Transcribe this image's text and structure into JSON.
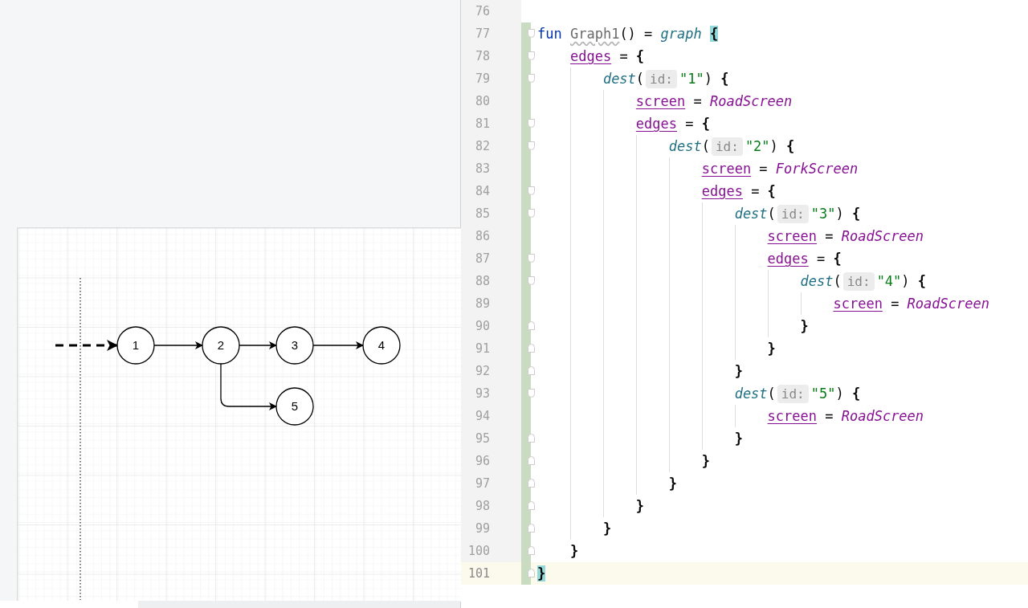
{
  "diagram": {
    "nodes": [
      {
        "label": "1"
      },
      {
        "label": "2"
      },
      {
        "label": "3"
      },
      {
        "label": "4"
      },
      {
        "label": "5"
      }
    ]
  },
  "editor": {
    "lines": [
      {
        "number": "76",
        "changed": false,
        "current": false,
        "kind": "plain"
      },
      {
        "number": "77",
        "changed": true,
        "current": false,
        "kind": "fold-start",
        "tokens": [
          {
            "kind": "keyword",
            "text": "fun "
          },
          {
            "kind": "unused",
            "text": "Graph1"
          },
          {
            "kind": "plain",
            "text": "() = "
          },
          {
            "kind": "call",
            "text": "graph "
          },
          {
            "kind": "brace-match",
            "text": "{"
          }
        ]
      },
      {
        "number": "78",
        "changed": true,
        "current": false,
        "kind": "fold-start",
        "tokens": [
          {
            "kind": "property",
            "text": "    edges"
          },
          {
            "kind": "plain",
            "text": " = "
          },
          {
            "kind": "brace",
            "text": "{"
          }
        ]
      },
      {
        "number": "79",
        "changed": true,
        "current": false,
        "kind": "fold-start",
        "tokens": [
          {
            "kind": "call",
            "text": "        dest"
          },
          {
            "kind": "plain",
            "text": "("
          },
          {
            "kind": "hint",
            "text": "id:"
          },
          {
            "kind": "string",
            "text": "\"1\""
          },
          {
            "kind": "plain",
            "text": ") "
          },
          {
            "kind": "brace",
            "text": "{"
          }
        ]
      },
      {
        "number": "80",
        "changed": true,
        "current": false,
        "kind": "plain",
        "tokens": [
          {
            "kind": "property",
            "text": "            screen"
          },
          {
            "kind": "plain",
            "text": " = "
          },
          {
            "kind": "type",
            "text": "RoadScreen"
          }
        ]
      },
      {
        "number": "81",
        "changed": true,
        "current": false,
        "kind": "fold-start",
        "tokens": [
          {
            "kind": "property",
            "text": "            edges"
          },
          {
            "kind": "plain",
            "text": " = "
          },
          {
            "kind": "brace",
            "text": "{"
          }
        ]
      },
      {
        "number": "82",
        "changed": true,
        "current": false,
        "kind": "fold-start",
        "tokens": [
          {
            "kind": "call",
            "text": "                dest"
          },
          {
            "kind": "plain",
            "text": "("
          },
          {
            "kind": "hint",
            "text": "id:"
          },
          {
            "kind": "string",
            "text": "\"2\""
          },
          {
            "kind": "plain",
            "text": ") "
          },
          {
            "kind": "brace",
            "text": "{"
          }
        ]
      },
      {
        "number": "83",
        "changed": true,
        "current": false,
        "kind": "plain",
        "tokens": [
          {
            "kind": "property",
            "text": "                    screen"
          },
          {
            "kind": "plain",
            "text": " = "
          },
          {
            "kind": "type",
            "text": "ForkScreen"
          }
        ]
      },
      {
        "number": "84",
        "changed": true,
        "current": false,
        "kind": "fold-start",
        "tokens": [
          {
            "kind": "property",
            "text": "                    edges"
          },
          {
            "kind": "plain",
            "text": " = "
          },
          {
            "kind": "brace",
            "text": "{"
          }
        ]
      },
      {
        "number": "85",
        "changed": true,
        "current": false,
        "kind": "fold-start",
        "tokens": [
          {
            "kind": "call",
            "text": "                        dest"
          },
          {
            "kind": "plain",
            "text": "("
          },
          {
            "kind": "hint",
            "text": "id:"
          },
          {
            "kind": "string",
            "text": "\"3\""
          },
          {
            "kind": "plain",
            "text": ") "
          },
          {
            "kind": "brace",
            "text": "{"
          }
        ]
      },
      {
        "number": "86",
        "changed": true,
        "current": false,
        "kind": "plain",
        "tokens": [
          {
            "kind": "property",
            "text": "                            screen"
          },
          {
            "kind": "plain",
            "text": " = "
          },
          {
            "kind": "type",
            "text": "RoadScreen"
          }
        ]
      },
      {
        "number": "87",
        "changed": true,
        "current": false,
        "kind": "fold-start",
        "tokens": [
          {
            "kind": "property",
            "text": "                            edges"
          },
          {
            "kind": "plain",
            "text": " = "
          },
          {
            "kind": "brace",
            "text": "{"
          }
        ]
      },
      {
        "number": "88",
        "changed": true,
        "current": false,
        "kind": "fold-start",
        "tokens": [
          {
            "kind": "call",
            "text": "                                dest"
          },
          {
            "kind": "plain",
            "text": "("
          },
          {
            "kind": "hint",
            "text": "id:"
          },
          {
            "kind": "string",
            "text": "\"4\""
          },
          {
            "kind": "plain",
            "text": ") "
          },
          {
            "kind": "brace",
            "text": "{"
          }
        ]
      },
      {
        "number": "89",
        "changed": true,
        "current": false,
        "kind": "plain",
        "tokens": [
          {
            "kind": "property",
            "text": "                                    screen"
          },
          {
            "kind": "plain",
            "text": " = "
          },
          {
            "kind": "type",
            "text": "RoadScreen"
          }
        ]
      },
      {
        "number": "90",
        "changed": true,
        "current": false,
        "kind": "fold-end",
        "tokens": [
          {
            "kind": "brace",
            "text": "                                }"
          }
        ]
      },
      {
        "number": "91",
        "changed": true,
        "current": false,
        "kind": "fold-end",
        "tokens": [
          {
            "kind": "brace",
            "text": "                            }"
          }
        ]
      },
      {
        "number": "92",
        "changed": true,
        "current": false,
        "kind": "fold-end",
        "tokens": [
          {
            "kind": "brace",
            "text": "                        }"
          }
        ]
      },
      {
        "number": "93",
        "changed": true,
        "current": false,
        "kind": "fold-start",
        "tokens": [
          {
            "kind": "call",
            "text": "                        dest"
          },
          {
            "kind": "plain",
            "text": "("
          },
          {
            "kind": "hint",
            "text": "id:"
          },
          {
            "kind": "string",
            "text": "\"5\""
          },
          {
            "kind": "plain",
            "text": ") "
          },
          {
            "kind": "brace",
            "text": "{"
          }
        ]
      },
      {
        "number": "94",
        "changed": true,
        "current": false,
        "kind": "plain",
        "tokens": [
          {
            "kind": "property",
            "text": "                            screen"
          },
          {
            "kind": "plain",
            "text": " = "
          },
          {
            "kind": "type",
            "text": "RoadScreen"
          }
        ]
      },
      {
        "number": "95",
        "changed": true,
        "current": false,
        "kind": "fold-end",
        "tokens": [
          {
            "kind": "brace",
            "text": "                        }"
          }
        ]
      },
      {
        "number": "96",
        "changed": true,
        "current": false,
        "kind": "fold-end",
        "tokens": [
          {
            "kind": "brace",
            "text": "                    }"
          }
        ]
      },
      {
        "number": "97",
        "changed": true,
        "current": false,
        "kind": "fold-end",
        "tokens": [
          {
            "kind": "brace",
            "text": "                }"
          }
        ]
      },
      {
        "number": "98",
        "changed": true,
        "current": false,
        "kind": "fold-end",
        "tokens": [
          {
            "kind": "brace",
            "text": "            }"
          }
        ]
      },
      {
        "number": "99",
        "changed": true,
        "current": false,
        "kind": "fold-end",
        "tokens": [
          {
            "kind": "brace",
            "text": "        }"
          }
        ]
      },
      {
        "number": "100",
        "changed": true,
        "current": false,
        "kind": "fold-end",
        "tokens": [
          {
            "kind": "brace",
            "text": "    }"
          }
        ]
      },
      {
        "number": "101",
        "changed": true,
        "current": true,
        "kind": "fold-end",
        "tokens": [
          {
            "kind": "brace-match",
            "text": "}"
          }
        ]
      }
    ]
  }
}
